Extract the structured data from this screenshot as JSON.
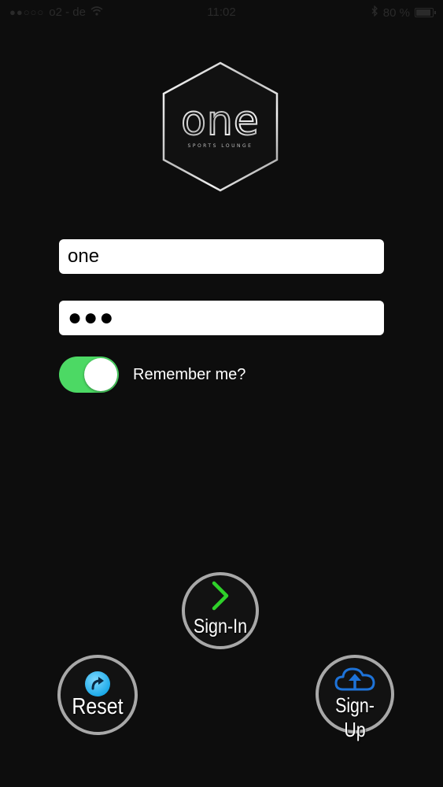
{
  "status_bar": {
    "signal_dots": "●●○○○",
    "carrier": "o2 - de",
    "time": "11:02",
    "battery_percent": "80 %",
    "icons": [
      "signal-dots-icon",
      "wifi-icon",
      "bluetooth-icon",
      "battery-icon"
    ]
  },
  "logo": {
    "wordmark": "one",
    "tagline": "SPORTS LOUNGE"
  },
  "login_form": {
    "username_value": "one",
    "password_value": "●●●",
    "remember_label": "Remember me?",
    "remember_enabled": true
  },
  "buttons": {
    "signin_label": "Sign-In",
    "reset_label": "Reset",
    "signup_label": "Sign-Up"
  },
  "colors": {
    "background": "#0d0d0d",
    "toggle_on": "#4cd964",
    "signin_chevron": "#2fd12a",
    "reset_icon": "#1aa9e8",
    "signup_icon": "#1e73d8",
    "button_ring": "#a8a8a8"
  }
}
